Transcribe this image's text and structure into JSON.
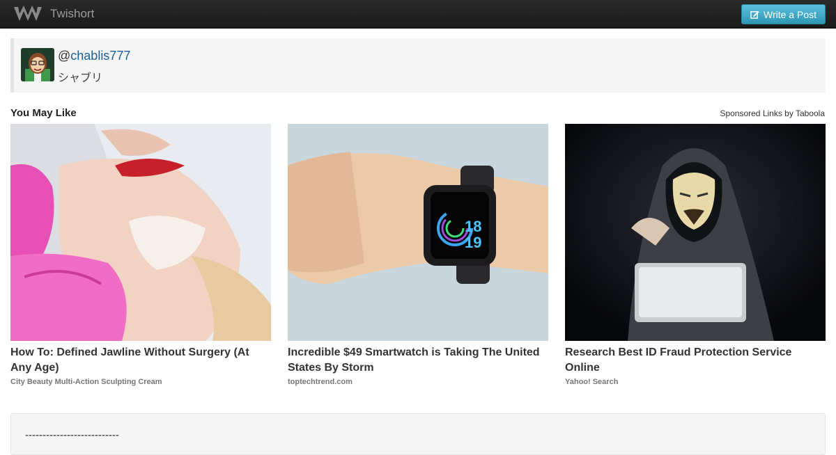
{
  "navbar": {
    "brand": "Twishort",
    "logo_icon": "twishort-logo-icon",
    "write_button_label": "Write a Post",
    "write_button_icon": "edit-icon",
    "colors": {
      "bar": "#222222",
      "button": "#49afcd"
    }
  },
  "profile": {
    "handle_prefix": "@",
    "handle": "chablis777",
    "display_name": "シャブリ",
    "avatar": "avatar-image"
  },
  "recommendations": {
    "heading": "You May Like",
    "sponsored": "Sponsored Links by Taboola",
    "cards": [
      {
        "title": "How To: Defined Jawline Without Surgery (At Any Age)",
        "source": "City Beauty Multi-Action Sculpting Cream",
        "image": "jawline-photo"
      },
      {
        "title": "Incredible $49 Smartwatch is Taking The United States By Storm",
        "source": "toptechtrend.com",
        "image": "smartwatch-photo",
        "watch_time_top": "18",
        "watch_time_bottom": "19"
      },
      {
        "title": "Research Best ID Fraud Protection Service Online",
        "source": "Yahoo! Search",
        "image": "hacker-photo"
      }
    ]
  },
  "post": {
    "text": "---------------------------"
  }
}
